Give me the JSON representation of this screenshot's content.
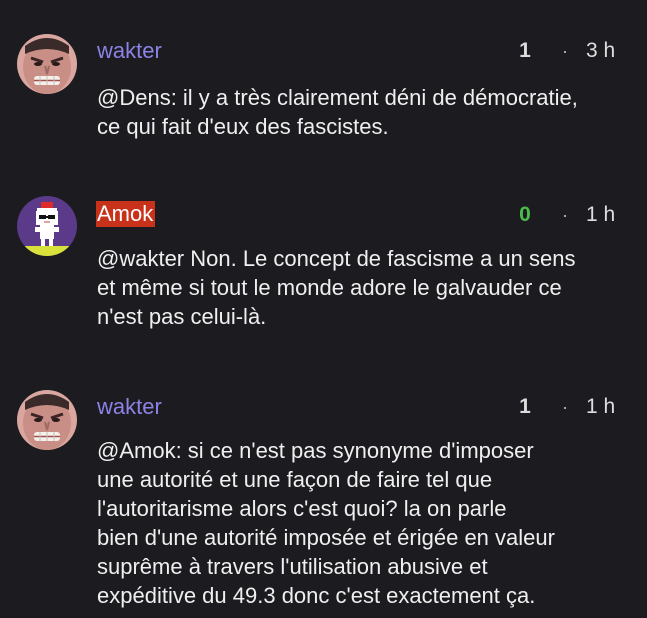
{
  "comments": [
    {
      "author": "wakter",
      "avatar": "angry-face-avatar",
      "score": "1",
      "separator": "·",
      "time": "3 h",
      "text": "@Dens: il y a très clairement déni de démocratie,\nce qui fait d'eux des fascistes."
    },
    {
      "author": "Amok",
      "avatar": "pixel-cat-sunglasses-avatar",
      "author_highlight_color": "#c8321a",
      "score": "0",
      "score_color": "#4cbb4c",
      "separator": "·",
      "time": "1 h",
      "text": "@wakter Non. Le concept de fascisme a un sens\net même si tout le monde adore le galvauder ce\nn'est pas celui-là."
    },
    {
      "author": "wakter",
      "avatar": "angry-face-avatar",
      "score": "1",
      "separator": "·",
      "time": "1 h",
      "text": "@Amok: si ce n'est pas synonyme d'imposer\nune autorité et une façon de faire tel que\nl'autoritarisme alors c'est quoi? la on parle\nbien d'une autorité imposée et érigée en valeur\nsuprême à travers l'utilisation abusive et\nexpéditive du 49.3  donc c'est exactement ça."
    }
  ]
}
